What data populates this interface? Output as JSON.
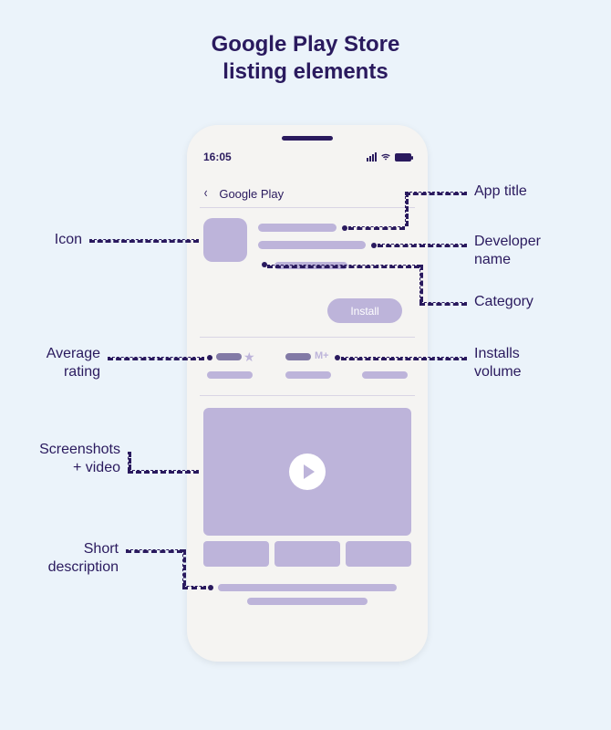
{
  "title_line1": "Google Play Store",
  "title_line2": "listing elements",
  "phone": {
    "time": "16:05",
    "nav_label": "Google Play",
    "install_label": "Install",
    "installs_suffix": "M+"
  },
  "labels": {
    "icon": "Icon",
    "app_title": "App title",
    "developer_name_l1": "Developer",
    "developer_name_l2": "name",
    "category": "Category",
    "avg_rating_l1": "Average",
    "avg_rating_l2": "rating",
    "installs_l1": "Installs",
    "installs_l2": "volume",
    "screenshots_l1": "Screenshots",
    "screenshots_l2": "+ video",
    "short_desc_l1": "Short",
    "short_desc_l2": "description"
  }
}
